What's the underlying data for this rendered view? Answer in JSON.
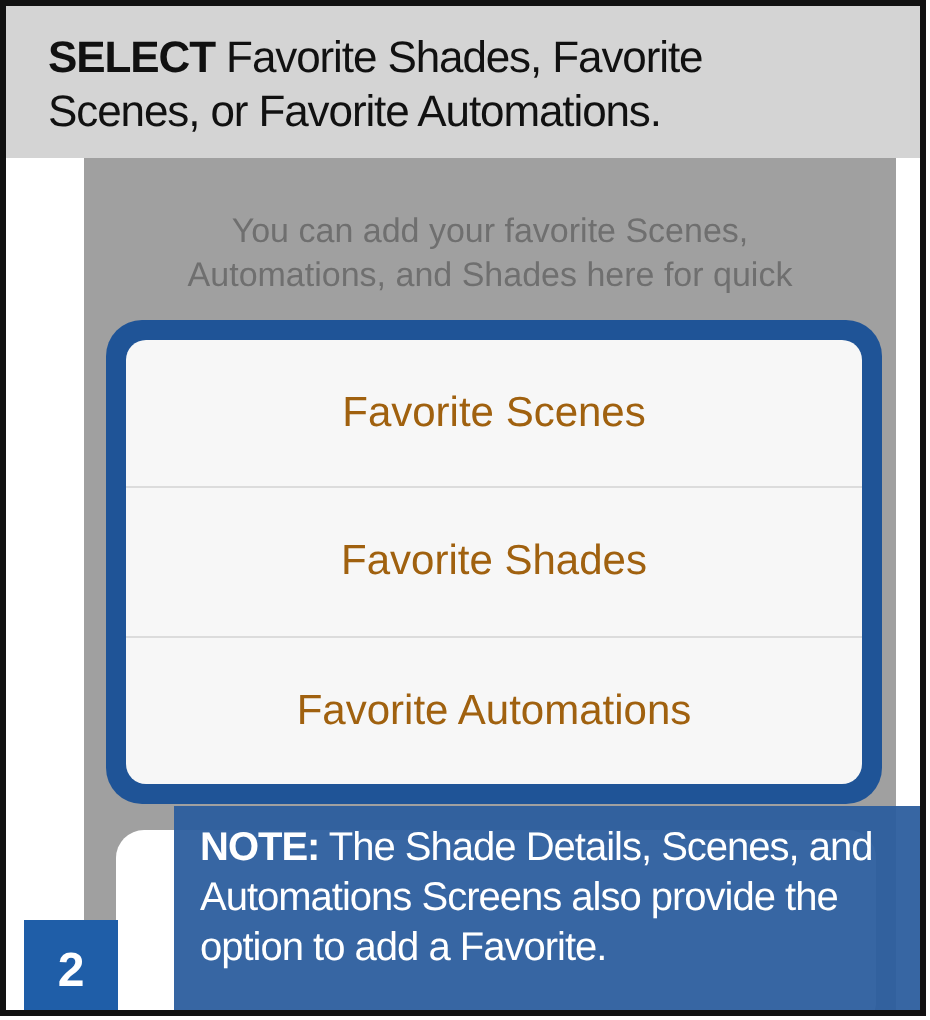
{
  "instruction": "**SELECT** Favorite Shades, Favorite Scenes, or Favorite Automations.",
  "screen": {
    "message": "You can add your favorite Scenes, Automations, and Shades here for quick",
    "options": [
      {
        "label": "Favorite Scenes"
      },
      {
        "label": "Favorite Shades"
      },
      {
        "label": "Favorite Automations"
      }
    ]
  },
  "note": "**NOTE:**  The Shade Details, Scenes, and Automations Screens also provide the option to add a Favorite.",
  "step_number": "2"
}
